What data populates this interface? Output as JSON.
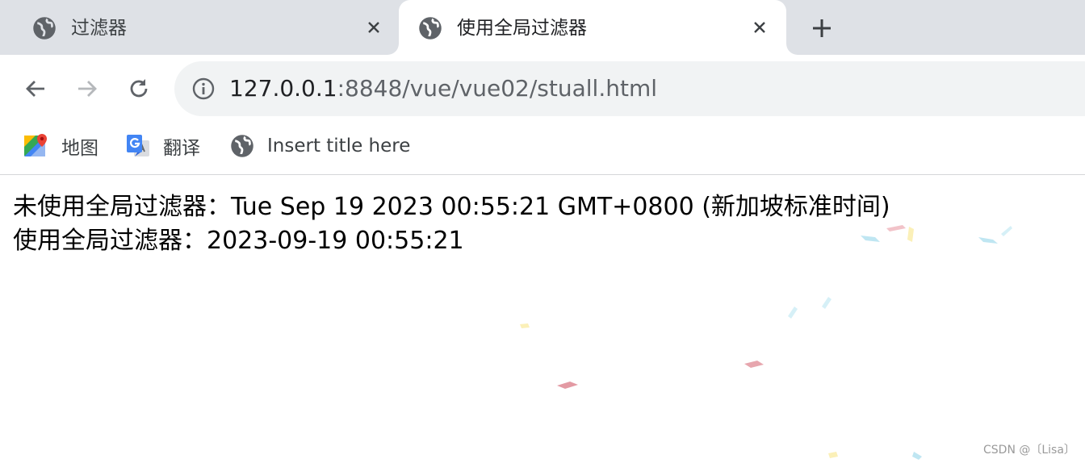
{
  "tabs": [
    {
      "title": "过滤器",
      "favicon": "globe-icon",
      "active": false
    },
    {
      "title": "使用全局过滤器",
      "favicon": "globe-icon",
      "active": true
    }
  ],
  "toolbar": {
    "back_icon": "arrow-left-icon",
    "forward_icon": "arrow-right-icon",
    "reload_icon": "reload-icon"
  },
  "address_bar": {
    "host": "127.0.0.1",
    "rest": ":8848/vue/vue02/stuall.html",
    "info_icon": "info-icon"
  },
  "bookmarks": [
    {
      "label": "地图",
      "icon": "google-maps-icon"
    },
    {
      "label": "翻译",
      "icon": "google-translate-icon"
    },
    {
      "label": "Insert title here",
      "icon": "globe-icon"
    }
  ],
  "page": {
    "line1": "未使用全局过滤器：Tue Sep 19 2023 00:55:21 GMT+0800 (新加坡标准时间)",
    "line2": "使用全局过滤器：2023-09-19 00:55:21"
  },
  "watermark": "CSDN @〔Lisa〕",
  "colors": {
    "tabstrip_bg": "#dee1e6",
    "omnibox_bg": "#f1f3f4",
    "icon_gray": "#5f6368",
    "text_dark": "#202124"
  }
}
